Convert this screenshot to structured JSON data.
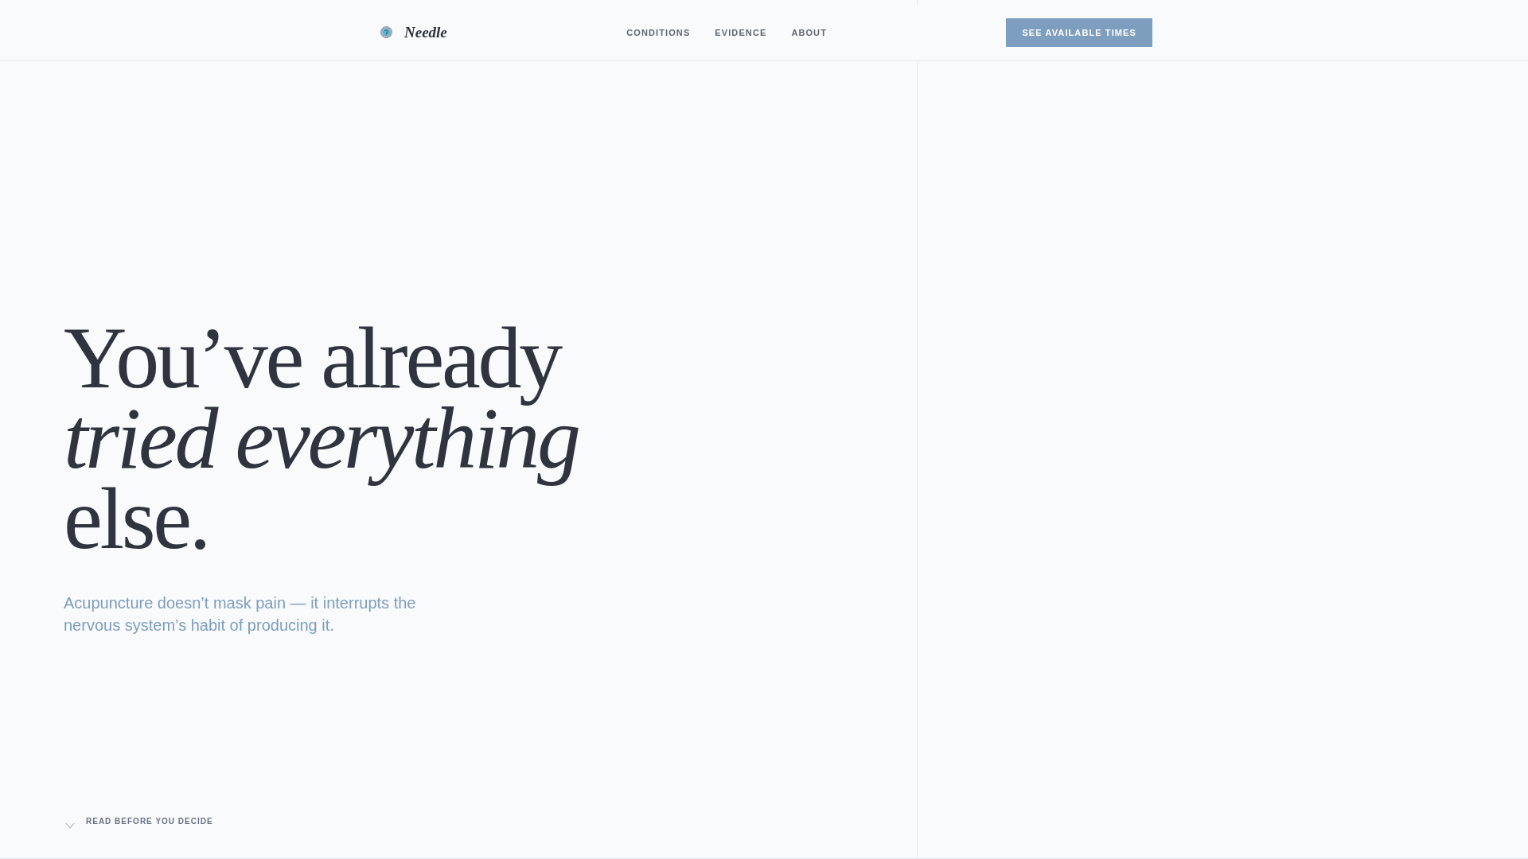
{
  "header": {
    "brand": "Needle",
    "nav": [
      "CONDITIONS",
      "EVIDENCE",
      "ABOUT"
    ],
    "cta_button": "SEE AVAILABLE TIMES"
  },
  "hero": {
    "headline": "You’ve already *tried everything* else.",
    "subtitle": "Acupuncture doesn’t mask pain — it interrupts the nervous system’s habit of producing it.",
    "scroll_cue": "READ BEFORE YOU DECIDE"
  }
}
